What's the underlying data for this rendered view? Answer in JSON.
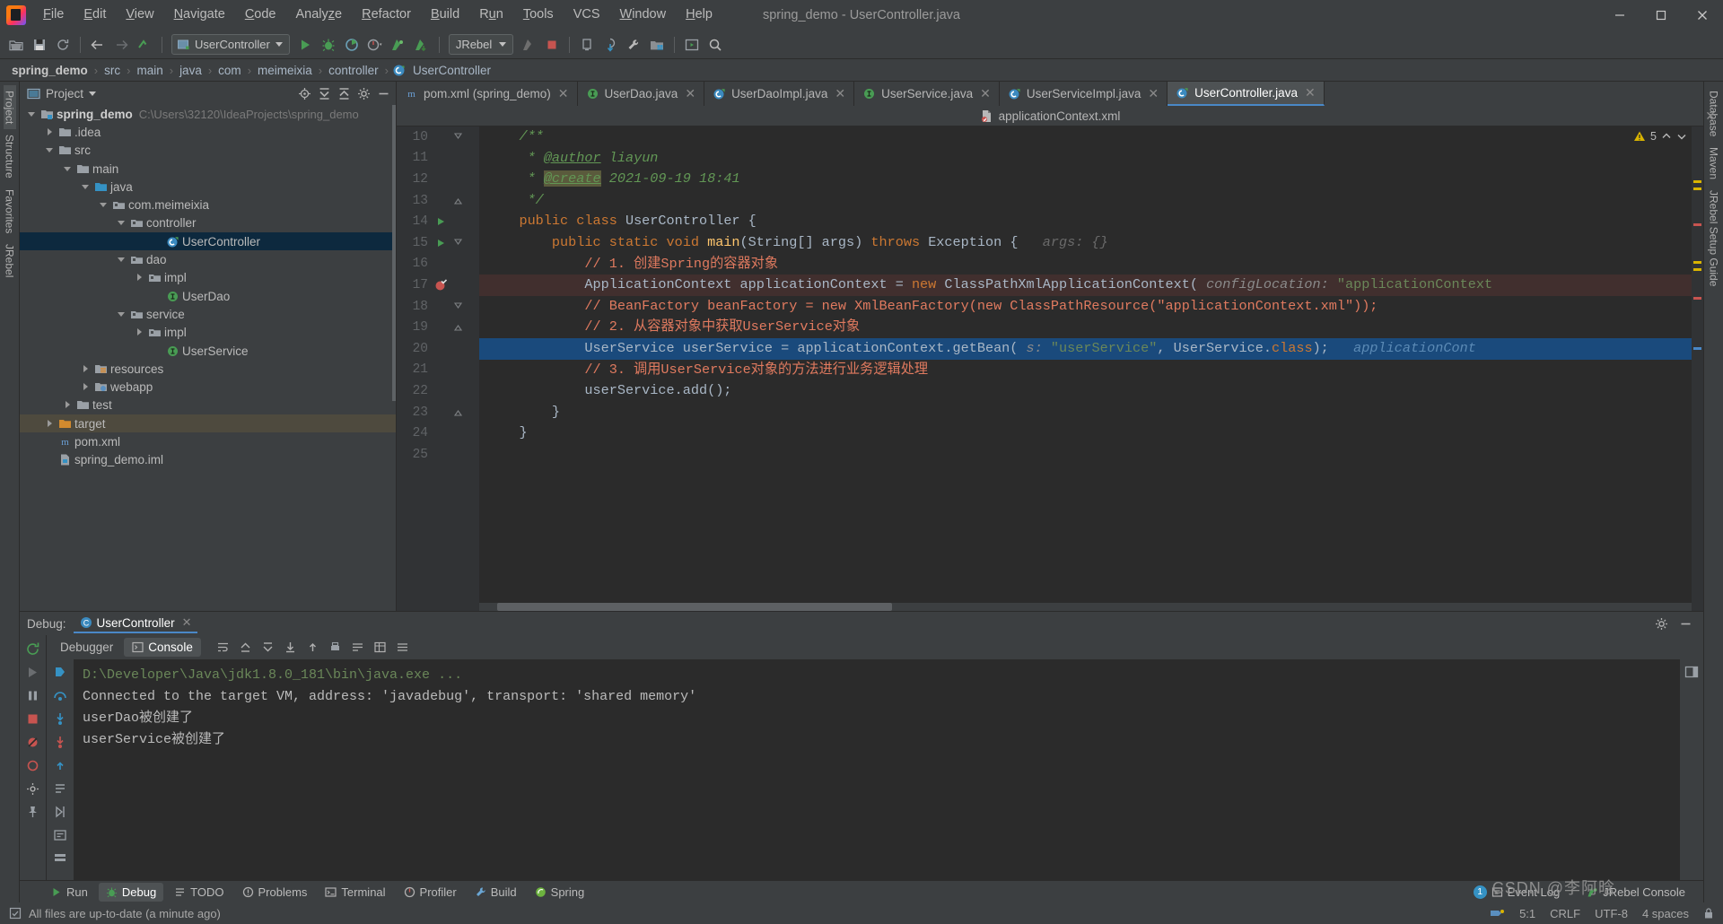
{
  "window": {
    "title": "spring_demo - UserController.java",
    "controls": [
      "minimize",
      "maximize",
      "close"
    ]
  },
  "menubar": {
    "items": [
      {
        "label": "File",
        "mnemonic": "F"
      },
      {
        "label": "Edit",
        "mnemonic": "E"
      },
      {
        "label": "View",
        "mnemonic": "V"
      },
      {
        "label": "Navigate",
        "mnemonic": "N"
      },
      {
        "label": "Code",
        "mnemonic": "C"
      },
      {
        "label": "Analyze",
        "mnemonic": "z"
      },
      {
        "label": "Refactor",
        "mnemonic": "R"
      },
      {
        "label": "Build",
        "mnemonic": "B"
      },
      {
        "label": "Run",
        "mnemonic": "u"
      },
      {
        "label": "Tools",
        "mnemonic": "T"
      },
      {
        "label": "VCS",
        "mnemonic": ""
      },
      {
        "label": "Window",
        "mnemonic": "W"
      },
      {
        "label": "Help",
        "mnemonic": "H"
      }
    ]
  },
  "toolbar": {
    "run_config": "UserController",
    "jrebel_config": "JRebel",
    "icons": [
      "open-folder-icon",
      "save-all-icon",
      "sync-icon",
      "back-arrow-icon",
      "forward-arrow-icon",
      "undo-icon",
      "run-icon",
      "debug-icon",
      "coverage-icon",
      "profile-icon",
      "jrebel-run-icon",
      "jrebel-debug-icon",
      "stop-icon",
      "update-app-icon",
      "vcs-update-icon",
      "build-icon",
      "settings-wrench-icon",
      "project-structure-icon",
      "web-preview-icon",
      "search-everywhere-icon"
    ]
  },
  "breadcrumb": {
    "items": [
      "spring_demo",
      "src",
      "main",
      "java",
      "com",
      "meimeixia",
      "controller",
      "UserController"
    ],
    "separator": "›"
  },
  "left_strip": {
    "labels": [
      "Project",
      "Structure",
      "Favorites",
      "JRebel"
    ]
  },
  "right_strip": {
    "labels": [
      "Database",
      "Maven",
      "JRebel Setup Guide"
    ]
  },
  "project_panel": {
    "title": "Project",
    "actions": [
      "locate-icon",
      "expand-all-icon",
      "collapse-all-icon",
      "settings-gear-icon",
      "hide-icon"
    ],
    "tree": [
      {
        "label": "spring_demo",
        "path": "C:\\Users\\32120\\IdeaProjects\\spring_demo",
        "indent": 0,
        "arrow": "down",
        "icon": "project-module-icon",
        "bold": true,
        "state": "normal"
      },
      {
        "label": ".idea",
        "path": "",
        "indent": 1,
        "arrow": "right",
        "icon": "folder-icon",
        "bold": false,
        "state": "normal"
      },
      {
        "label": "src",
        "path": "",
        "indent": 1,
        "arrow": "down",
        "icon": "folder-icon",
        "bold": false,
        "state": "normal"
      },
      {
        "label": "main",
        "path": "",
        "indent": 2,
        "arrow": "down",
        "icon": "folder-icon",
        "bold": false,
        "state": "normal"
      },
      {
        "label": "java",
        "path": "",
        "indent": 3,
        "arrow": "down",
        "icon": "source-folder-icon",
        "bold": false,
        "state": "normal"
      },
      {
        "label": "com.meimeixia",
        "path": "",
        "indent": 4,
        "arrow": "down",
        "icon": "package-icon",
        "bold": false,
        "state": "normal"
      },
      {
        "label": "controller",
        "path": "",
        "indent": 5,
        "arrow": "down",
        "icon": "package-icon",
        "bold": false,
        "state": "normal"
      },
      {
        "label": "UserController",
        "path": "",
        "indent": 7,
        "arrow": "none",
        "icon": "java-class-icon",
        "bold": false,
        "state": "selected"
      },
      {
        "label": "dao",
        "path": "",
        "indent": 5,
        "arrow": "down",
        "icon": "package-icon",
        "bold": false,
        "state": "normal"
      },
      {
        "label": "impl",
        "path": "",
        "indent": 6,
        "arrow": "right",
        "icon": "package-icon",
        "bold": false,
        "state": "normal"
      },
      {
        "label": "UserDao",
        "path": "",
        "indent": 7,
        "arrow": "none",
        "icon": "java-interface-icon",
        "bold": false,
        "state": "normal"
      },
      {
        "label": "service",
        "path": "",
        "indent": 5,
        "arrow": "down",
        "icon": "package-icon",
        "bold": false,
        "state": "normal"
      },
      {
        "label": "impl",
        "path": "",
        "indent": 6,
        "arrow": "right",
        "icon": "package-icon",
        "bold": false,
        "state": "normal"
      },
      {
        "label": "UserService",
        "path": "",
        "indent": 7,
        "arrow": "none",
        "icon": "java-interface-icon",
        "bold": false,
        "state": "normal"
      },
      {
        "label": "resources",
        "path": "",
        "indent": 3,
        "arrow": "right",
        "icon": "resources-folder-icon",
        "bold": false,
        "state": "normal"
      },
      {
        "label": "webapp",
        "path": "",
        "indent": 3,
        "arrow": "right",
        "icon": "webapp-folder-icon",
        "bold": false,
        "state": "normal"
      },
      {
        "label": "test",
        "path": "",
        "indent": 2,
        "arrow": "right",
        "icon": "folder-icon",
        "bold": false,
        "state": "normal"
      },
      {
        "label": "target",
        "path": "",
        "indent": 1,
        "arrow": "right",
        "icon": "excluded-folder-icon",
        "bold": false,
        "state": "target"
      },
      {
        "label": "pom.xml",
        "path": "",
        "indent": 1,
        "arrow": "none",
        "icon": "maven-icon",
        "bold": false,
        "state": "normal"
      },
      {
        "label": "spring_demo.iml",
        "path": "",
        "indent": 1,
        "arrow": "none",
        "icon": "iml-icon",
        "bold": false,
        "state": "normal"
      }
    ]
  },
  "editor": {
    "tabs": [
      {
        "label": "pom.xml (spring_demo)",
        "icon": "maven-icon",
        "active": false,
        "closable": true
      },
      {
        "label": "UserDao.java",
        "icon": "java-interface-icon",
        "active": false,
        "closable": true
      },
      {
        "label": "UserDaoImpl.java",
        "icon": "java-class-icon",
        "active": false,
        "closable": true
      },
      {
        "label": "UserService.java",
        "icon": "java-interface-icon",
        "active": false,
        "closable": true
      },
      {
        "label": "UserServiceImpl.java",
        "icon": "java-class-icon",
        "active": false,
        "closable": true
      },
      {
        "label": "UserController.java",
        "icon": "java-class-icon",
        "active": true,
        "closable": true
      }
    ],
    "context_file": "applicationContext.xml",
    "inspection_count": "5",
    "lines": [
      {
        "num": "10",
        "state": "normal",
        "gutter_icon": "fold-collapse",
        "run_icon": "",
        "segments": [
          {
            "t": "/**",
            "c": "cmt",
            "indent": 4
          }
        ]
      },
      {
        "num": "11",
        "state": "normal",
        "gutter_icon": "",
        "run_icon": "",
        "segments": [
          {
            "t": " * ",
            "c": "cmt",
            "indent": 4
          },
          {
            "t": "@author",
            "c": "anno-u"
          },
          {
            "t": " liayun",
            "c": "cmt"
          }
        ]
      },
      {
        "num": "12",
        "state": "normal",
        "gutter_icon": "",
        "run_icon": "",
        "segments": [
          {
            "t": " * ",
            "c": "cmt",
            "indent": 4
          },
          {
            "t": "@create",
            "c": "anno-hl"
          },
          {
            "t": " 2021-09-19 18:41",
            "c": "cmt"
          }
        ]
      },
      {
        "num": "13",
        "state": "normal",
        "gutter_icon": "fold-end",
        "run_icon": "",
        "segments": [
          {
            "t": " */",
            "c": "cmt",
            "indent": 4
          }
        ]
      },
      {
        "num": "14",
        "state": "normal",
        "gutter_icon": "",
        "run_icon": "run",
        "segments": [
          {
            "t": "public class ",
            "c": "kw",
            "indent": 4
          },
          {
            "t": "UserController ",
            "c": "cls"
          },
          {
            "t": "{",
            "c": "cls"
          }
        ]
      },
      {
        "num": "15",
        "state": "normal",
        "gutter_icon": "fold-collapse",
        "run_icon": "run",
        "segments": [
          {
            "t": "public static void ",
            "c": "kw",
            "indent": 8
          },
          {
            "t": "main",
            "c": "fn"
          },
          {
            "t": "(String[] args) ",
            "c": "cls"
          },
          {
            "t": "throws ",
            "c": "kw"
          },
          {
            "t": "Exception {   ",
            "c": "cls"
          },
          {
            "t": "args: {}",
            "c": "hint"
          }
        ]
      },
      {
        "num": "16",
        "state": "normal",
        "gutter_icon": "",
        "run_icon": "",
        "segments": [
          {
            "t": "// 1. 创建Spring的容器对象",
            "c": "cmt2",
            "indent": 12
          }
        ]
      },
      {
        "num": "17",
        "state": "breakpoint",
        "gutter_icon": "",
        "run_icon": "breakpoint",
        "segments": [
          {
            "t": "ApplicationContext applicationContext = ",
            "c": "cls",
            "indent": 12
          },
          {
            "t": "new ",
            "c": "kw"
          },
          {
            "t": "ClassPathXmlApplicationContext(",
            "c": "cls"
          },
          {
            "t": " configLocation: ",
            "c": "hintpill"
          },
          {
            "t": "\"applicationContext",
            "c": "str"
          }
        ]
      },
      {
        "num": "18",
        "state": "normal",
        "gutter_icon": "fold-collapse",
        "run_icon": "",
        "segments": [
          {
            "t": "// BeanFactory beanFactory = new XmlBeanFactory(new ClassPathResource(\"applicationContext.xml\"));",
            "c": "cmt2",
            "indent": 12
          }
        ]
      },
      {
        "num": "19",
        "state": "normal",
        "gutter_icon": "fold-end",
        "run_icon": "",
        "segments": [
          {
            "t": "// 2. 从容器对象中获取UserService对象",
            "c": "cmt2",
            "indent": 12
          }
        ]
      },
      {
        "num": "20",
        "state": "executing",
        "gutter_icon": "",
        "run_icon": "",
        "segments": [
          {
            "t": "UserService userService = applicationContext.getBean(",
            "c": "cls",
            "indent": 12
          },
          {
            "t": " s: ",
            "c": "hintpill"
          },
          {
            "t": "\"userService\"",
            "c": "str"
          },
          {
            "t": ", UserService.",
            "c": "cls"
          },
          {
            "t": "class",
            "c": "kw"
          },
          {
            "t": ");   ",
            "c": "cls"
          },
          {
            "t": "applicationCont",
            "c": "dbgval"
          }
        ]
      },
      {
        "num": "21",
        "state": "normal",
        "gutter_icon": "",
        "run_icon": "",
        "segments": [
          {
            "t": "// 3. 调用UserService对象的方法进行业务逻辑处理",
            "c": "cmt2",
            "indent": 12
          }
        ]
      },
      {
        "num": "22",
        "state": "normal",
        "gutter_icon": "",
        "run_icon": "",
        "segments": [
          {
            "t": "userService.add();",
            "c": "cls",
            "indent": 12
          }
        ]
      },
      {
        "num": "23",
        "state": "normal",
        "gutter_icon": "fold-end",
        "run_icon": "",
        "segments": [
          {
            "t": "}",
            "c": "cls",
            "indent": 8
          }
        ]
      },
      {
        "num": "24",
        "state": "normal",
        "gutter_icon": "",
        "run_icon": "",
        "segments": [
          {
            "t": "}",
            "c": "cls",
            "indent": 4
          }
        ]
      },
      {
        "num": "25",
        "state": "normal",
        "gutter_icon": "",
        "run_icon": "",
        "segments": []
      }
    ]
  },
  "debug": {
    "label": "Debug:",
    "session_tab": "UserController",
    "tabs": [
      {
        "label": "Debugger",
        "icon": "",
        "active": false
      },
      {
        "label": "Console",
        "icon": "console-icon",
        "active": true
      }
    ],
    "toolbar_icons": [
      "rerun-icon",
      "resume-icon",
      "pause-icon",
      "stop-icon",
      "mute-breakpoints-icon",
      "view-breakpoints-icon",
      "settings-icon",
      "pin-icon"
    ],
    "step_icons": [
      "show-execution-point-icon",
      "step-over-icon",
      "step-into-icon",
      "force-step-into-icon",
      "step-out-icon",
      "drop-frame-icon",
      "run-to-cursor-icon",
      "evaluate-icon",
      "thread-icon"
    ],
    "console_lines": [
      {
        "text": "D:\\Developer\\Java\\jdk1.8.0_181\\bin\\java.exe ...",
        "style": "dim"
      },
      {
        "text": "Connected to the target VM, address: 'javadebug', transport: 'shared memory'",
        "style": "normal"
      },
      {
        "text": "userDao被创建了",
        "style": "normal"
      },
      {
        "text": "userService被创建了",
        "style": "normal"
      }
    ]
  },
  "bottom_bar": {
    "items": [
      {
        "label": "Run",
        "icon": "run-icon",
        "active": false
      },
      {
        "label": "Debug",
        "icon": "debug-icon",
        "active": true
      },
      {
        "label": "TODO",
        "icon": "todo-icon",
        "active": false
      },
      {
        "label": "Problems",
        "icon": "problems-icon",
        "active": false
      },
      {
        "label": "Terminal",
        "icon": "terminal-icon",
        "active": false
      },
      {
        "label": "Profiler",
        "icon": "profiler-icon",
        "active": false
      },
      {
        "label": "Build",
        "icon": "build-icon",
        "active": false
      },
      {
        "label": "Spring",
        "icon": "spring-icon",
        "active": false
      }
    ],
    "right": [
      {
        "label": "Event Log",
        "badge": "1",
        "icon": "event-log-icon"
      },
      {
        "label": "JRebel Console",
        "badge": "",
        "icon": "jrebel-icon"
      }
    ]
  },
  "status_bar": {
    "message": "All files are up-to-date (a minute ago)",
    "caret": "5:1",
    "line_separator": "CRLF",
    "encoding": "UTF-8",
    "indent": "4 spaces",
    "icons": [
      "save-status-icon",
      "notifications-icon",
      "lock-icon"
    ]
  },
  "watermark": {
    "csdn": "CSDN @李阿晗"
  },
  "colors": {
    "accent": "#4a88c7",
    "selection": "#0d293e",
    "exec_line": "#1a4a7c",
    "breakpoint_line": "#412f2e",
    "editor_bg": "#2b2b2b",
    "chrome_bg": "#3c3f41",
    "gutter_bg": "#313335"
  }
}
